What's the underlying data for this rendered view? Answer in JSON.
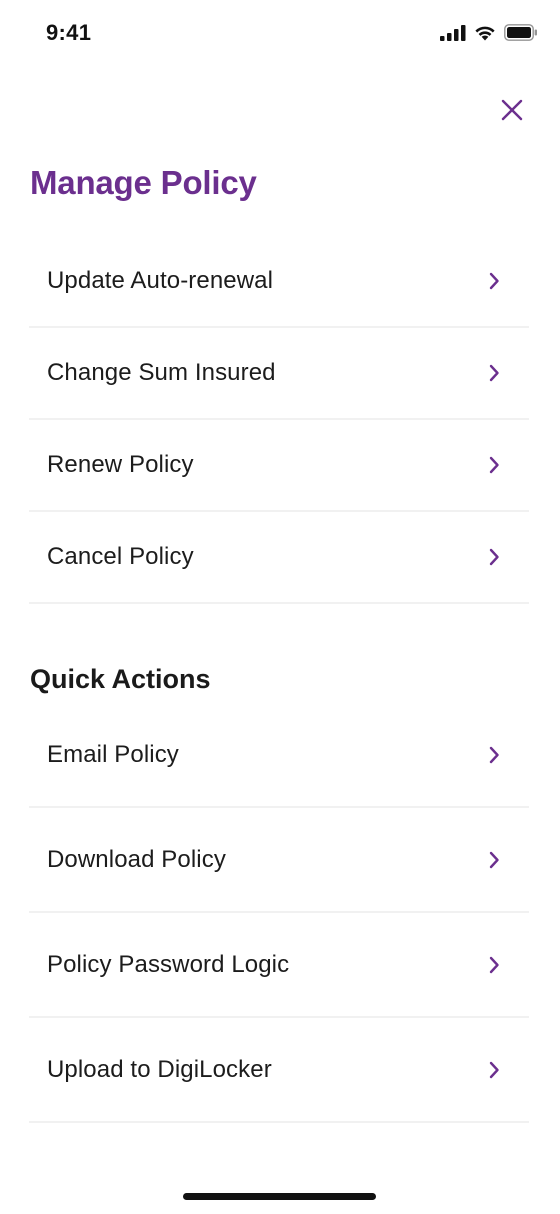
{
  "status_bar": {
    "time": "9:41",
    "icons": [
      "cellular-signal-icon",
      "wifi-icon",
      "battery-icon"
    ]
  },
  "header": {
    "close_icon": "close-icon",
    "title": "Manage Policy"
  },
  "manage_items": [
    {
      "label": "Update Auto-renewal"
    },
    {
      "label": "Change Sum Insured"
    },
    {
      "label": "Renew Policy"
    },
    {
      "label": "Cancel Policy"
    }
  ],
  "quick_actions": {
    "title": "Quick Actions",
    "items": [
      {
        "label": "Email Policy"
      },
      {
        "label": "Download Policy"
      },
      {
        "label": "Policy Password Logic"
      },
      {
        "label": "Upload to DigiLocker"
      }
    ]
  },
  "colors": {
    "accent": "#6b2f8e",
    "divider": "#f1f1f1",
    "text": "#1c1c1c"
  }
}
